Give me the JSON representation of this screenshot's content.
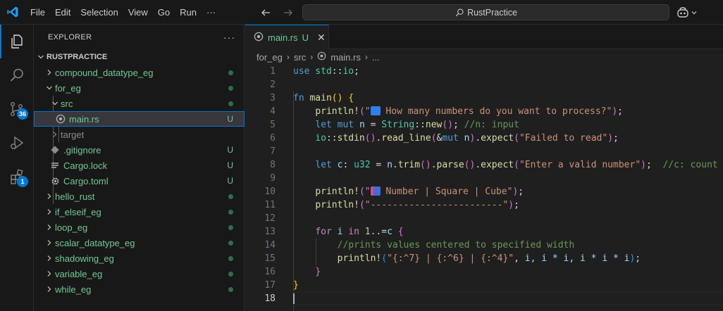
{
  "titlebar": {
    "menu": [
      "File",
      "Edit",
      "Selection",
      "View",
      "Go",
      "Run",
      "···"
    ],
    "search_text": "RustPractice"
  },
  "activitybar": {
    "source_control_badge": "36",
    "extensions_badge": "1"
  },
  "explorer": {
    "title": "EXPLORER",
    "more": "···",
    "root": "RUSTPRACTICE",
    "items": [
      {
        "label": "compound_datatype_eg",
        "status": "dot"
      },
      {
        "label": "for_eg",
        "status": "dot"
      },
      {
        "label": "src",
        "status": "dot"
      },
      {
        "label": "main.rs",
        "status": "U"
      },
      {
        "label": "target",
        "status": ""
      },
      {
        "label": ".gitignore",
        "status": "U"
      },
      {
        "label": "Cargo.lock",
        "status": "U"
      },
      {
        "label": "Cargo.toml",
        "status": "U"
      },
      {
        "label": "hello_rust",
        "status": "dot"
      },
      {
        "label": "if_elseif_eg",
        "status": "dot"
      },
      {
        "label": "loop_eg",
        "status": "dot"
      },
      {
        "label": "scalar_datatype_eg",
        "status": "dot"
      },
      {
        "label": "shadowing_eg",
        "status": "dot"
      },
      {
        "label": "variable_eg",
        "status": "dot"
      },
      {
        "label": "while_eg",
        "status": "dot"
      }
    ]
  },
  "editor": {
    "tab": {
      "label": "main.rs",
      "status": "U"
    },
    "breadcrumb": [
      "for_eg",
      "src",
      "main.rs",
      "..."
    ],
    "line_numbers": [
      "1",
      "2",
      "3",
      "4",
      "5",
      "6",
      "7",
      "8",
      "9",
      "10",
      "11",
      "12",
      "13",
      "14",
      "15",
      "16",
      "17",
      "18"
    ],
    "current_line": "18",
    "code": {
      "l1_kw": "use",
      "l1_rest": " std",
      "l1_sep": "::",
      "l1_mod": "io",
      "l1_end": ";",
      "l3_kw": "fn",
      "l3_name": "main",
      "l4_mac": "println!",
      "l4_str": "\" How many numbers do you want to process?\"",
      "l5_let": "let",
      "l5_mut": "mut",
      "l5_var": "n",
      "l5_type": "String",
      "l5_fn": "new",
      "l5_cmt": "//n: input",
      "l6_mod": "io",
      "l6_fn1": "stdin",
      "l6_fn2": "read_line",
      "l6_mut": "mut",
      "l6_var": "n",
      "l6_fn3": "expect",
      "l6_str": "\"Failed to read\"",
      "l8_let": "let",
      "l8_var": "c",
      "l8_type": "u32",
      "l8_var2": "n",
      "l8_fn1": "trim",
      "l8_fn2": "parse",
      "l8_fn3": "expect",
      "l8_str": "\"Enter a valid number\"",
      "l8_cmt": "//c: count",
      "l10_mac": "println!",
      "l10_str": "\" Number | Square | Cube\"",
      "l11_mac": "println!",
      "l11_str": "\"------------------------\"",
      "l13_for": "for",
      "l13_var": "i",
      "l13_in": "in",
      "l13_n": "1",
      "l13_range": "..=",
      "l13_c": "c",
      "l14_cmt": "//prints values centered to specified width",
      "l15_mac": "println!",
      "l15_str": "\"{:^7} | {:^6} | {:^4}\"",
      "l15_args": "i, i * i, i * i * i"
    }
  }
}
